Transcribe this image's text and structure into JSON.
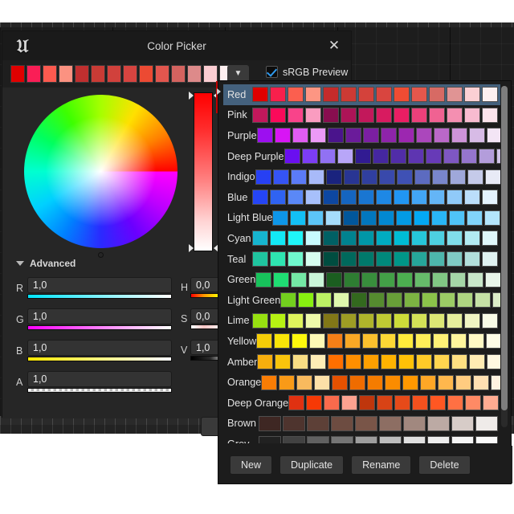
{
  "window": {
    "title": "Color Picker",
    "logo_icon": "unreal-engine-logo",
    "close_icon": "close-icon"
  },
  "swatch_strip": {
    "dropdown_icon": "chevron-down-icon",
    "srgb_label": "sRGB Preview",
    "srgb_checked": true,
    "colors": [
      "#e00000",
      "#fa1e56",
      "#fc5a4f",
      "#fb9281",
      "#c02f2f",
      "#c93b35",
      "#d1413c",
      "#d64440",
      "#ec4a33",
      "#e2564e",
      "#d4635f",
      "#dd8a8a",
      "#fbcdd2",
      "#fdeff0"
    ]
  },
  "wheel": {
    "name": "color-wheel",
    "cursor_name": "color-wheel-cursor"
  },
  "value_slider": {
    "name": "value-slider"
  },
  "advanced": {
    "label": "Advanced",
    "expanded": true,
    "arrow_icon": "triangle-down-icon"
  },
  "rgba": [
    {
      "label": "R",
      "value": "1,0",
      "track": "t-r"
    },
    {
      "label": "G",
      "value": "1,0",
      "track": "t-g"
    },
    {
      "label": "B",
      "value": "1,0",
      "track": "t-b"
    },
    {
      "label": "A",
      "value": "1,0",
      "track": "t-a"
    }
  ],
  "hsv": [
    {
      "label": "H",
      "value": "0,0",
      "track": "t-h"
    },
    {
      "label": "S",
      "value": "0,0",
      "track": "t-s"
    },
    {
      "label": "V",
      "value": "1,0",
      "track": "t-v"
    }
  ],
  "palette_popup": {
    "selected_row": "Red",
    "scrollbar_name": "palette-scrollbar",
    "buttons": [
      {
        "label": "New",
        "name": "new-button"
      },
      {
        "label": "Duplicate",
        "name": "duplicate-button"
      },
      {
        "label": "Rename",
        "name": "rename-button"
      },
      {
        "label": "Delete",
        "name": "delete-button"
      }
    ],
    "rows": [
      {
        "name": "Red",
        "wide": false,
        "colors": [
          "#e00000",
          "#f8204c",
          "#fb5f4f",
          "#fd9683",
          "#c52b2b",
          "#cc3a34",
          "#d4423b",
          "#d9453f",
          "#ef4c33",
          "#e5574c",
          "#d76a64",
          "#e09494",
          "#fbd0d4",
          "#fdf0f1"
        ]
      },
      {
        "name": "Pink",
        "wide": false,
        "colors": [
          "#c2185b",
          "#fa0a5a",
          "#f9438a",
          "#fa9cc0",
          "#880e4f",
          "#ad1457",
          "#c2185b",
          "#d81b60",
          "#e91e63",
          "#ec407a",
          "#f06292",
          "#f48fb1",
          "#f8bbd0",
          "#fce4ec"
        ]
      },
      {
        "name": "Purple",
        "wide": false,
        "colors": [
          "#9c0ff0",
          "#d815f5",
          "#e05cf2",
          "#ec9af7",
          "#4a148c",
          "#6a1b9a",
          "#7b1fa2",
          "#8e24aa",
          "#9c27b0",
          "#ab47bc",
          "#ba68c8",
          "#ce93d8",
          "#d7bbe6",
          "#f3e5f5"
        ]
      },
      {
        "name": "Deep Purple",
        "wide": false,
        "colors": [
          "#6a0ff0",
          "#7c3df5",
          "#9171f3",
          "#b8a6f8",
          "#311b92",
          "#4527a0",
          "#512da8",
          "#5e35b1",
          "#673ab7",
          "#7e57c2",
          "#9575cd",
          "#b39ddb",
          "#d1c4e9",
          "#ede7f6"
        ]
      },
      {
        "name": "Indigo",
        "wide": false,
        "colors": [
          "#2740f3",
          "#3554f4",
          "#5b7bf7",
          "#a8baf9",
          "#1a237e",
          "#283593",
          "#303f9f",
          "#3949ab",
          "#3f51b5",
          "#5c6bc0",
          "#7986cb",
          "#9fa8da",
          "#c5cae9",
          "#e8eaf6"
        ]
      },
      {
        "name": "Blue",
        "wide": false,
        "colors": [
          "#2545f5",
          "#2f63f2",
          "#5a88f7",
          "#a7c0fb",
          "#0d47a1",
          "#1565c0",
          "#1976d2",
          "#1e88e5",
          "#2196f3",
          "#42a5f5",
          "#64b5f6",
          "#90caf9",
          "#bbdefb",
          "#e3f2fd"
        ]
      },
      {
        "name": "Light Blue",
        "wide": false,
        "colors": [
          "#0e96e8",
          "#13c0f5",
          "#5cc5f7",
          "#a5dcfb",
          "#01579b",
          "#0277bd",
          "#0288d1",
          "#039be5",
          "#03a9f4",
          "#29b6f6",
          "#4fc3f7",
          "#81d4fa",
          "#b3e5fc",
          "#e1f5fe"
        ]
      },
      {
        "name": "Cyan",
        "wide": false,
        "colors": [
          "#16b5cf",
          "#12e8f5",
          "#1ff6f8",
          "#c7fbfd",
          "#006064",
          "#00838f",
          "#0097a7",
          "#00acc1",
          "#00bcd4",
          "#26c6da",
          "#4dd0e1",
          "#80deea",
          "#b2ebf2",
          "#e0f7fa"
        ]
      },
      {
        "name": "Teal",
        "wide": false,
        "colors": [
          "#1fc49f",
          "#2ee5b1",
          "#6ff8cd",
          "#d6fdef",
          "#004d40",
          "#00695c",
          "#00796b",
          "#00897b",
          "#009688",
          "#26a69a",
          "#4db6ac",
          "#80cbc4",
          "#b2dfdb",
          "#e0f2f1"
        ]
      },
      {
        "name": "Green",
        "wide": false,
        "colors": [
          "#17c25b",
          "#1fdd73",
          "#74e8a5",
          "#caf5d9",
          "#1b5e20",
          "#2e7d32",
          "#388e3c",
          "#43a047",
          "#4caf50",
          "#66bb6a",
          "#81c784",
          "#a5d6a7",
          "#c8e6c9",
          "#e8f5e9"
        ]
      },
      {
        "name": "Light Green",
        "wide": false,
        "colors": [
          "#73cf1e",
          "#88f010",
          "#bcf264",
          "#dff8ad",
          "#33691e",
          "#558b2f",
          "#689f38",
          "#7cb342",
          "#8bc34a",
          "#9ccc65",
          "#aed581",
          "#c5e1a5",
          "#dcedc8",
          "#f1f8e9"
        ]
      },
      {
        "name": "Lime",
        "wide": false,
        "colors": [
          "#97e010",
          "#b6f213",
          "#dff45c",
          "#eefaa9",
          "#827717",
          "#9e9d24",
          "#afb42b",
          "#c0ca33",
          "#cddc39",
          "#d4e157",
          "#dce775",
          "#e6ee9c",
          "#f0f4c3",
          "#f9fbe7"
        ]
      },
      {
        "name": "Yellow",
        "wide": false,
        "colors": [
          "#f5cd07",
          "#f9e507",
          "#fdf80c",
          "#fcf9b5",
          "#f57f17",
          "#f9a825",
          "#fbc02d",
          "#fdd835",
          "#ffeb3b",
          "#ffee58",
          "#fff176",
          "#fff59d",
          "#fff9c4",
          "#fffde7"
        ]
      },
      {
        "name": "Amber",
        "wide": false,
        "colors": [
          "#f6ae0d",
          "#f9c40c",
          "#f8dd84",
          "#fdedb6",
          "#ff6f00",
          "#ff8f00",
          "#ffa000",
          "#ffb300",
          "#ffc107",
          "#ffca28",
          "#ffd54f",
          "#ffe082",
          "#ffecb3",
          "#fff8e1"
        ]
      },
      {
        "name": "Orange",
        "wide": false,
        "colors": [
          "#f97d05",
          "#f99a17",
          "#f8ba5e",
          "#fce0a8",
          "#e65100",
          "#ef6c00",
          "#f57c00",
          "#fb8c00",
          "#ff9800",
          "#ffa726",
          "#ffb74d",
          "#ffcc80",
          "#ffe0b2",
          "#fff3e0"
        ]
      },
      {
        "name": "Deep Orange",
        "wide": false,
        "colors": [
          "#e03111",
          "#f63905",
          "#fa6a4c",
          "#fca290",
          "#bf360c",
          "#d84315",
          "#e64a19",
          "#f4511e",
          "#ff5722",
          "#ff7043",
          "#ff8a65",
          "#ffab91",
          "#ffccbc",
          "#fbe9e7"
        ]
      },
      {
        "name": "Brown",
        "wide": true,
        "colors": [
          "#3e2723",
          "#4e342e",
          "#5d4037",
          "#6d4c41",
          "#795548",
          "#8d6e63",
          "#a1887f",
          "#bcaaa4",
          "#d7ccc8",
          "#efebe9"
        ]
      },
      {
        "name": "Grey",
        "wide": true,
        "colors": [
          "#212121",
          "#424242",
          "#616161",
          "#757575",
          "#9e9e9e",
          "#bdbdbd",
          "#e0e0e0",
          "#eeeeee",
          "#f5f5f5",
          "#fafafa"
        ]
      }
    ]
  }
}
